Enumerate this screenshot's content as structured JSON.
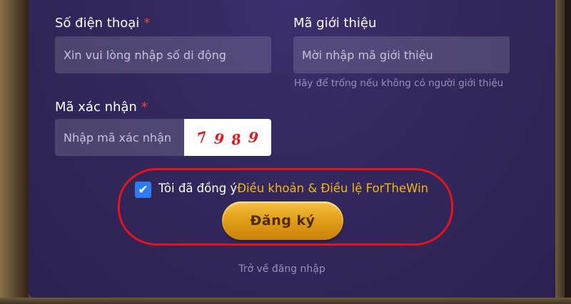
{
  "form": {
    "phone": {
      "label": "Số điện thoại",
      "required_mark": "*",
      "placeholder": "Xin vui lòng nhập số di động"
    },
    "referral": {
      "label": "Mã giới thiệu",
      "placeholder": "Mời nhập mã giới thiệu",
      "hint": "Hãy để trống nếu không có người giới thiệu"
    },
    "captcha": {
      "label": "Mã xác nhận",
      "required_mark": "*",
      "placeholder": "Nhập mã xác nhận",
      "code": [
        "7",
        "9",
        "8",
        "9"
      ]
    },
    "agree": {
      "checked": true,
      "checkmark": "✔",
      "text": "Tôi đã đồng ý",
      "terms_link": "Điều khoản & Điều lệ ForTheWin"
    },
    "register_button": "Đăng ký",
    "back_to_login": "Trở về đăng nhập"
  },
  "colors": {
    "required": "#ff3b3b",
    "link": "#f3b51c",
    "button": "#e2a11b",
    "highlight_circle": "#e3141c",
    "checkbox": "#2f7bf0"
  }
}
